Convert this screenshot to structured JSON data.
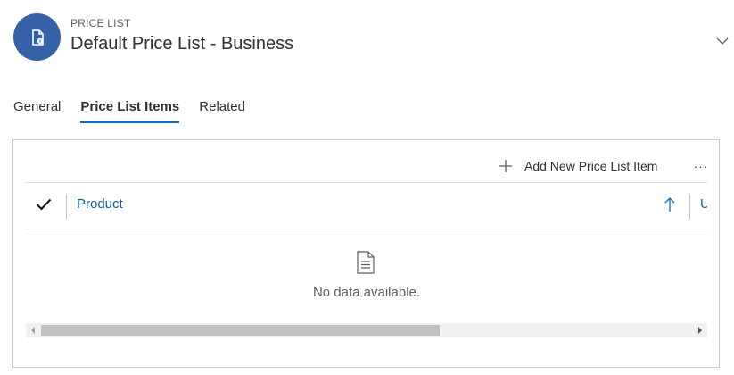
{
  "header": {
    "entity_type": "PRICE LIST",
    "record_title": "Default Price List - Business",
    "avatar_icon": "price-list-document-icon",
    "avatar_color": "#3461a8"
  },
  "tabs": [
    {
      "label": "General",
      "active": false
    },
    {
      "label": "Price List Items",
      "active": true
    },
    {
      "label": "Related",
      "active": false
    }
  ],
  "grid": {
    "add_button_label": "Add New Price List Item",
    "more_label": "···",
    "columns": [
      {
        "label": "Product",
        "sort": "ascending"
      },
      {
        "label": "U"
      }
    ],
    "empty_message": "No data available.",
    "scroll_position": 0.0,
    "scroll_visible_fraction": 0.6,
    "accent_color": "#0f6cbd"
  }
}
